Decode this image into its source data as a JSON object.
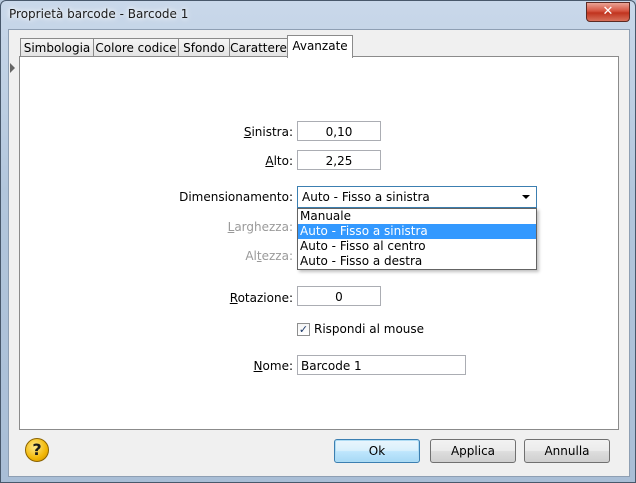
{
  "window": {
    "title": "Proprietà barcode - Barcode 1",
    "close_label": "✕"
  },
  "tabs": [
    {
      "label": "Simbologia"
    },
    {
      "label": "Colore codice"
    },
    {
      "label": "Sfondo"
    },
    {
      "label": "Carattere"
    },
    {
      "label": "Avanzate"
    }
  ],
  "form": {
    "sinistra": {
      "label_u": "S",
      "label_rest": "inistra:",
      "value": "0,10"
    },
    "alto": {
      "label_u": "A",
      "label_rest": "lto:",
      "value": "2,25"
    },
    "dimensionamento": {
      "label": "Dimensionamento:",
      "value": "Auto - Fisso a sinistra",
      "options": [
        "Manuale",
        "Auto - Fisso a sinistra",
        "Auto - Fisso al centro",
        "Auto - Fisso a destra"
      ]
    },
    "larghezza": {
      "label_u": "L",
      "label_rest": "arghezza:"
    },
    "altezza": {
      "label_pre": "Al",
      "label_u": "t",
      "label_rest": "ezza:"
    },
    "rotazione": {
      "label_u": "R",
      "label_rest": "otazione:",
      "value": "0"
    },
    "rispondi": {
      "check": "✓",
      "label": "Rispondi al mouse",
      "checked": true
    },
    "nome": {
      "label_u": "N",
      "label_rest": "ome:",
      "value": "Barcode 1"
    }
  },
  "buttons": {
    "help": "?",
    "ok": "Ok",
    "applica": "Applica",
    "annulla": "Annulla"
  }
}
